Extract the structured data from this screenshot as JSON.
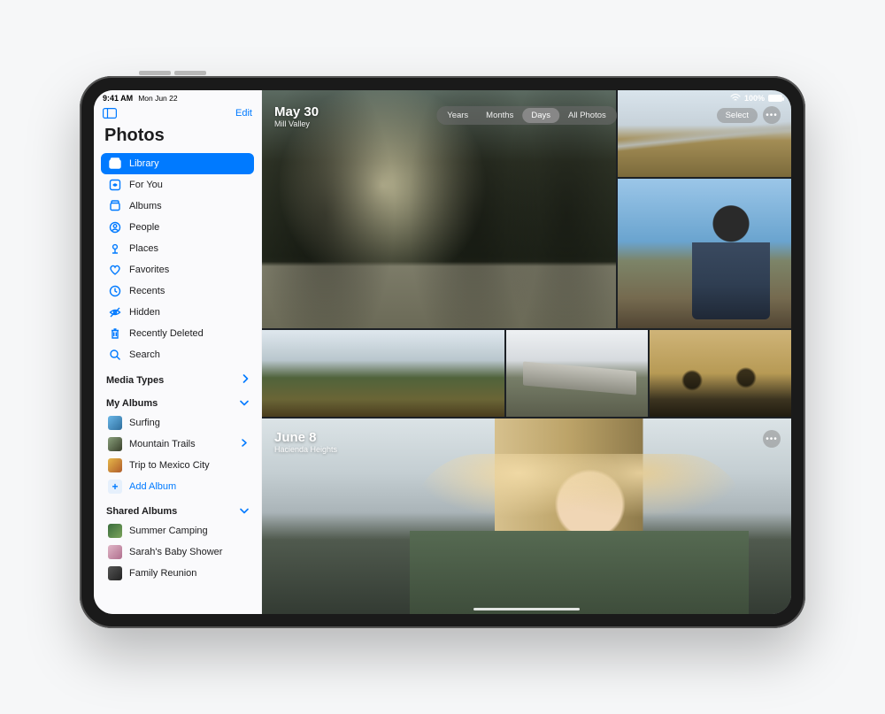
{
  "statusbar": {
    "time": "9:41 AM",
    "date": "Mon Jun 22",
    "battery_percent": "100%"
  },
  "sidebar": {
    "edit_label": "Edit",
    "title": "Photos",
    "nav": [
      {
        "label": "Library",
        "icon": "library-icon",
        "active": true
      },
      {
        "label": "For You",
        "icon": "foryou-icon",
        "active": false
      },
      {
        "label": "Albums",
        "icon": "albums-icon",
        "active": false
      },
      {
        "label": "People",
        "icon": "people-icon",
        "active": false
      },
      {
        "label": "Places",
        "icon": "places-icon",
        "active": false
      },
      {
        "label": "Favorites",
        "icon": "favorites-icon",
        "active": false
      },
      {
        "label": "Recents",
        "icon": "recents-icon",
        "active": false
      },
      {
        "label": "Hidden",
        "icon": "hidden-icon",
        "active": false
      },
      {
        "label": "Recently Deleted",
        "icon": "trash-icon",
        "active": false
      },
      {
        "label": "Search",
        "icon": "search-icon",
        "active": false
      }
    ],
    "sections": {
      "media_types": {
        "title": "Media Types"
      },
      "my_albums": {
        "title": "My Albums"
      },
      "shared": {
        "title": "Shared Albums"
      }
    },
    "my_albums": [
      {
        "label": "Surfing",
        "disclosure": false
      },
      {
        "label": "Mountain Trails",
        "disclosure": true
      },
      {
        "label": "Trip to Mexico City",
        "disclosure": false
      }
    ],
    "add_album_label": "Add Album",
    "shared_albums": [
      {
        "label": "Summer Camping"
      },
      {
        "label": "Sarah's Baby Shower"
      },
      {
        "label": "Family Reunion"
      }
    ]
  },
  "main": {
    "group1": {
      "date": "May 30",
      "location": "Mill Valley"
    },
    "group2": {
      "date": "June 8",
      "location": "Hacienda Heights"
    },
    "view_tabs": [
      "Years",
      "Months",
      "Days",
      "All Photos"
    ],
    "view_active": "Days",
    "select_label": "Select"
  }
}
